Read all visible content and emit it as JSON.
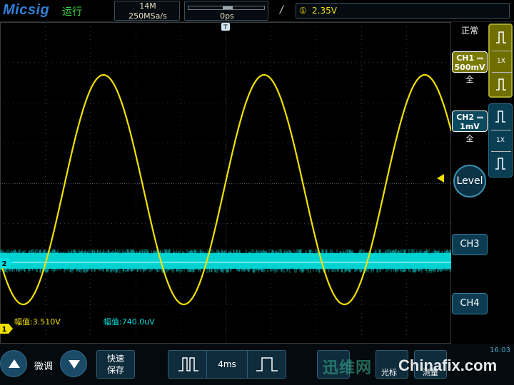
{
  "top": {
    "logo": "Micsig",
    "run_status": "运行",
    "memory_depth": "14M",
    "sample_rate": "250MSa/s",
    "time_position": "0ps",
    "trigger_slope": "/",
    "trigger_source": "①",
    "trigger_level": "2.35V"
  },
  "right": {
    "acq_mode": "正常",
    "ch1": {
      "label": "CH1",
      "coupling": "⎓",
      "scale": "500mV",
      "bandwidth": "全",
      "probe": "1X"
    },
    "ch2": {
      "label": "CH2",
      "coupling": "⎓",
      "scale": "1mV",
      "bandwidth": "全",
      "probe": "1X"
    },
    "level_button": "Level",
    "ch3_button": "CH3",
    "ch4_button": "CH4"
  },
  "screen": {
    "ch1_marker": "1",
    "ch2_marker": "2",
    "trigger_marker": "T",
    "ch1_measure": "幅值:3.510V",
    "ch2_measure": "幅值:740.0uV"
  },
  "bottom": {
    "fine_label": "微调",
    "quick_save_line1": "快速",
    "quick_save_line2": "保存",
    "timebase": "4ms",
    "cursor_label": "光标",
    "measure_label": "测量",
    "clock": "16:03",
    "watermark_cn": "迅维网",
    "watermark_url": "Chinafix.com"
  },
  "colors": {
    "ch1": "#f0e000",
    "ch2": "#00e0e0",
    "grid": "#3a3a3a",
    "accent": "#2f7fd6"
  }
}
